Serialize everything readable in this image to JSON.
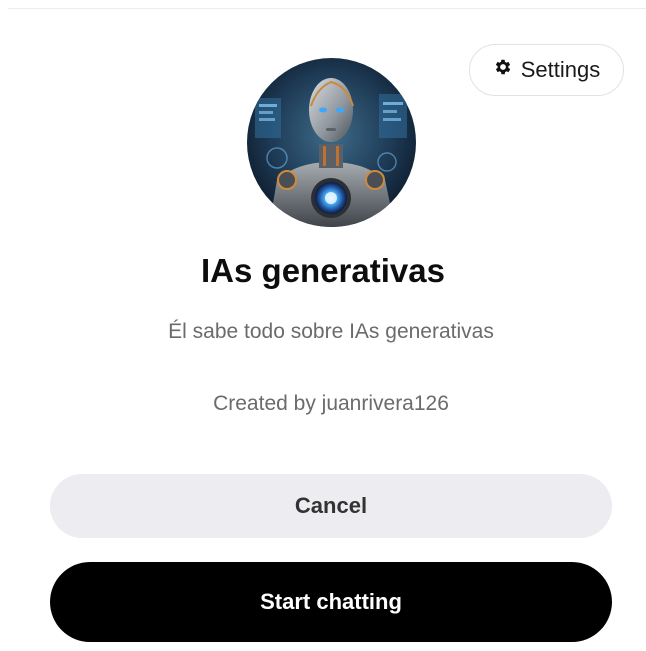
{
  "header": {
    "settings_label": "Settings",
    "settings_icon": "gear-icon"
  },
  "gpt": {
    "name": "IAs generativas",
    "description": "Él sabe todo sobre IAs generativas",
    "creator": "Created by juanrivera126",
    "avatar": "robot-avatar-image"
  },
  "actions": {
    "cancel_label": "Cancel",
    "start_label": "Start chatting"
  },
  "colors": {
    "primary_button": "#000000",
    "secondary_button": "#ececf1",
    "muted_text": "#6b6b6b"
  }
}
